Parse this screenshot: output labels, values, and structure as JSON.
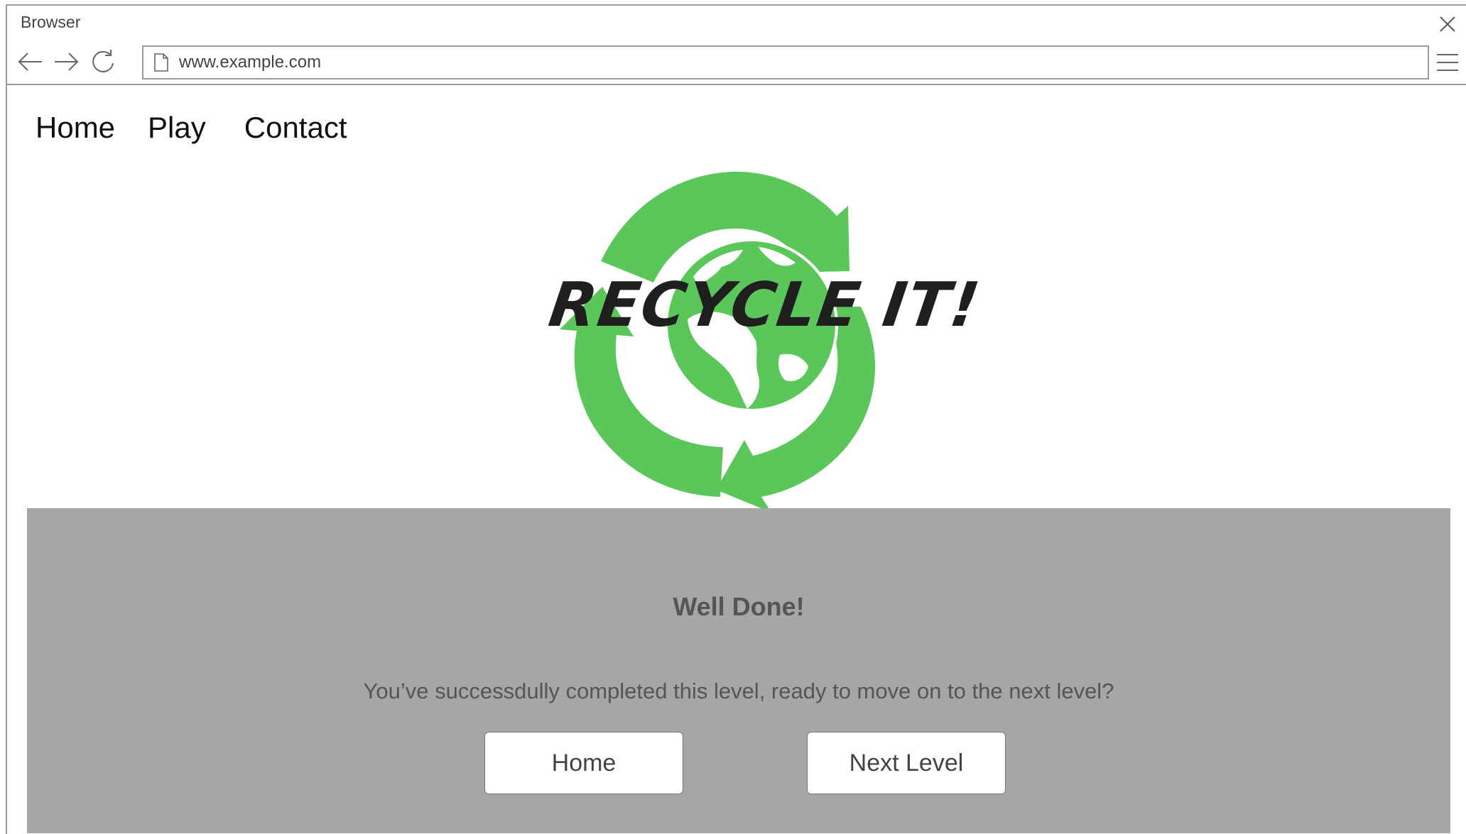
{
  "browser": {
    "window_title": "Browser",
    "url": "www.example.com",
    "icons": {
      "back": "arrow-left-icon",
      "forward": "arrow-right-icon",
      "reload": "reload-icon",
      "page": "page-icon",
      "menu": "hamburger-menu-icon",
      "close": "close-icon"
    }
  },
  "site_nav": {
    "items": [
      {
        "label": "Home"
      },
      {
        "label": "Play"
      },
      {
        "label": "Contact"
      }
    ]
  },
  "logo": {
    "text": "RECYCLE IT!",
    "colors": {
      "arrows": "#5bc75b",
      "globe": "#5bc75b",
      "text": "#1f1f1f"
    }
  },
  "panel": {
    "title": "Well Done!",
    "message": "You’ve successdully completed this level, ready to move on to the next level?",
    "buttons": {
      "home": "Home",
      "next_level": "Next Level"
    },
    "background": "#a6a6a6"
  }
}
